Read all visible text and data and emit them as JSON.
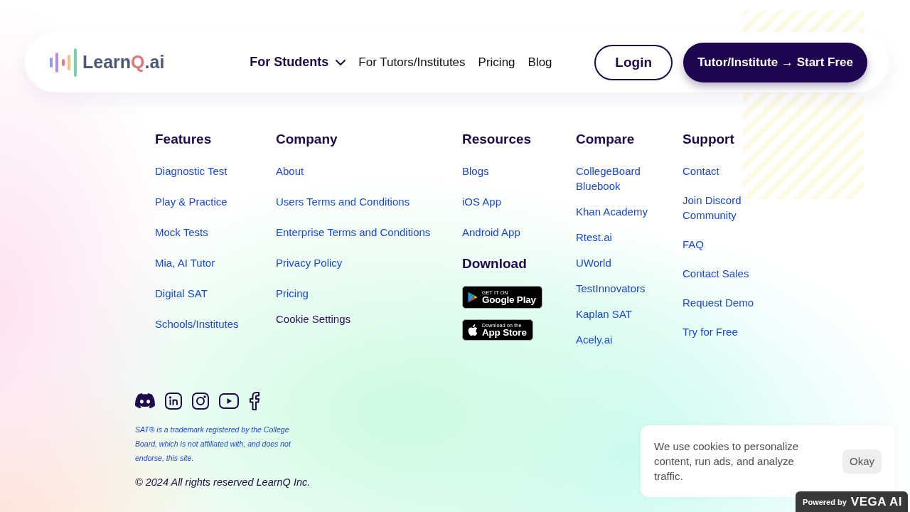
{
  "header": {
    "logo": {
      "parts": [
        {
          "text": "Learn",
          "accent": false
        },
        {
          "text": "Q",
          "accent": true
        },
        {
          "text": ".ai",
          "accent": false
        }
      ]
    },
    "nav": [
      {
        "label": "For Students",
        "selected": true,
        "dropdown": true
      },
      {
        "label": "For Tutors/Institutes",
        "selected": false,
        "dropdown": false
      },
      {
        "label": "Pricing",
        "selected": false,
        "dropdown": false
      },
      {
        "label": "Blog",
        "selected": false,
        "dropdown": false
      }
    ],
    "buttons": [
      {
        "label": "Login",
        "kind": "outline"
      },
      {
        "label": "Tutor/Institute → Start Free",
        "kind": "filled"
      }
    ]
  },
  "footer": {
    "columns": [
      {
        "heading": "Features",
        "links": [
          "Diagnostic Test",
          "Play & Practice",
          "Mock Tests",
          "Mia, AI Tutor",
          "Digital SAT",
          "Schools/Institutes"
        ]
      },
      {
        "heading": "Company",
        "links": [
          "About",
          "Users Terms and Conditions",
          "Enterprise Terms and Conditions",
          "Privacy Policy",
          "Pricing"
        ],
        "settings_button": "Cookie Settings"
      },
      {
        "heading": "Resources",
        "links": [
          "Blogs",
          "iOS App",
          "Android App"
        ],
        "download": {
          "heading": "Download",
          "badges": [
            {
              "kind": "google-play",
              "caption": "GET IT ON",
              "store": "Google Play"
            },
            {
              "kind": "app-store",
              "caption": "Download on the",
              "store": "App Store"
            }
          ]
        }
      },
      {
        "heading": "Compare",
        "links": [
          "CollegeBoard Bluebook",
          "Khan Academy",
          "Rtest.ai",
          "UWorld",
          "TestInnovators",
          "Kaplan SAT",
          "Acely.ai"
        ]
      },
      {
        "heading": "Support",
        "links": [
          "Contact",
          "Join Discord Community",
          "FAQ",
          "Contact Sales",
          "Request Demo",
          "Try for Free"
        ]
      }
    ],
    "social_links": [
      {
        "kind": "discord"
      },
      {
        "kind": "linkedin"
      },
      {
        "kind": "instagram"
      },
      {
        "kind": "youtube"
      },
      {
        "kind": "facebook"
      }
    ],
    "disclaimer": "SAT® is a trademark registered by the College Board, which is not affiliated with, and does not endorse, this site.",
    "copyright": "© 2024 All rights reserved LearnQ Inc."
  },
  "cookie_banner": {
    "message": "We use cookies to personalize content, run ads, and analyze traffic.",
    "button": "Okay"
  },
  "powered_by": {
    "label": "Powered by",
    "brand": "VEGA AI"
  }
}
